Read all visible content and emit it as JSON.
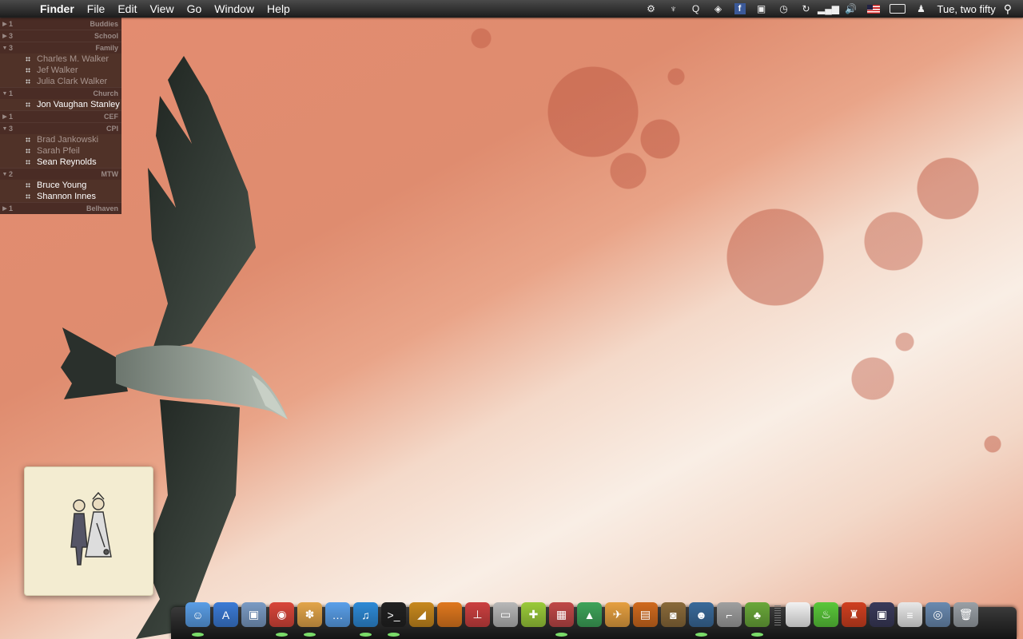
{
  "menubar": {
    "app_name": "Finder",
    "menus": [
      "File",
      "Edit",
      "View",
      "Go",
      "Window",
      "Help"
    ],
    "status_icons": [
      "gear-icon",
      "wine-glass-icon",
      "q-icon",
      "dropbox-icon",
      "facebook-icon",
      "display-icon",
      "time-machine-icon",
      "sync-icon",
      "signal-icon",
      "volume-icon",
      "us-flag-icon",
      "battery-icon",
      "user-icon"
    ],
    "facebook_glyph": "f",
    "clock": "Tue, two fifty"
  },
  "buddy_list": {
    "groups": [
      {
        "name": "Buddies",
        "count": "1",
        "expanded": false,
        "buddies": []
      },
      {
        "name": "School",
        "count": "3",
        "expanded": false,
        "buddies": []
      },
      {
        "name": "Family",
        "count": "3",
        "expanded": true,
        "buddies": [
          {
            "name": "Charles M. Walker",
            "status": "away"
          },
          {
            "name": "Jef Walker",
            "status": "away"
          },
          {
            "name": "Julia Clark Walker",
            "status": "away"
          }
        ]
      },
      {
        "name": "Church",
        "count": "1",
        "expanded": true,
        "buddies": [
          {
            "name": "Jon Vaughan Stanley",
            "status": "online"
          }
        ]
      },
      {
        "name": "CEF",
        "count": "1",
        "expanded": false,
        "buddies": []
      },
      {
        "name": "CPI",
        "count": "3",
        "expanded": true,
        "buddies": [
          {
            "name": "Brad Jankowski",
            "status": "away"
          },
          {
            "name": "Sarah Pfeil",
            "status": "away"
          },
          {
            "name": "Sean Reynolds",
            "status": "online"
          }
        ]
      },
      {
        "name": "MTW",
        "count": "2",
        "expanded": true,
        "buddies": [
          {
            "name": "Bruce Young",
            "status": "online"
          },
          {
            "name": "Shannon Innes",
            "status": "online"
          }
        ]
      },
      {
        "name": "Belhaven",
        "count": "1",
        "expanded": false,
        "buddies": []
      }
    ]
  },
  "dock": {
    "apps": [
      {
        "name": "finder-icon",
        "color": "#5a9ee6",
        "running": true,
        "glyph": "☺"
      },
      {
        "name": "app-store-icon",
        "color": "#3b7bd6",
        "running": false,
        "glyph": "A"
      },
      {
        "name": "preview-icon",
        "color": "#7b9bc4",
        "running": false,
        "glyph": "▣"
      },
      {
        "name": "chrome-icon",
        "color": "#d9463a",
        "running": true,
        "glyph": "◉"
      },
      {
        "name": "adium-icon",
        "color": "#e3a54a",
        "running": true,
        "glyph": "✽"
      },
      {
        "name": "ichat-icon",
        "color": "#5aa0ea",
        "running": false,
        "glyph": "…"
      },
      {
        "name": "itunes-icon",
        "color": "#2e8ad6",
        "running": true,
        "glyph": "♫"
      },
      {
        "name": "terminal-icon",
        "color": "#222222",
        "running": true,
        "glyph": ">_"
      },
      {
        "name": "coda-icon",
        "color": "#c8891e",
        "running": false,
        "glyph": "◢"
      },
      {
        "name": "presentation-icon",
        "color": "#e0781e",
        "running": false,
        "glyph": ""
      },
      {
        "name": "joystick-icon",
        "color": "#cc4040",
        "running": false,
        "glyph": "⊥"
      },
      {
        "name": "printer-icon",
        "color": "#b8b8b8",
        "running": false,
        "glyph": "▭"
      },
      {
        "name": "puzzle-icon",
        "color": "#9bcb3a",
        "running": false,
        "glyph": "✚"
      },
      {
        "name": "photo-booth-icon",
        "color": "#c04848",
        "running": true,
        "glyph": "▦"
      },
      {
        "name": "delta-icon",
        "color": "#3ea45a",
        "running": false,
        "glyph": "▲"
      },
      {
        "name": "transmit-icon",
        "color": "#e6a040",
        "running": false,
        "glyph": "✈"
      },
      {
        "name": "keynote-icon",
        "color": "#d06a1e",
        "running": false,
        "glyph": "▤"
      },
      {
        "name": "image-capture-icon",
        "color": "#8a6a3a",
        "running": false,
        "glyph": "◙"
      },
      {
        "name": "ninja-icon",
        "color": "#3a6a9a",
        "running": true,
        "glyph": "☻"
      },
      {
        "name": "wrench-icon",
        "color": "#a0a0a0",
        "running": false,
        "glyph": "⌐"
      },
      {
        "name": "plant-icon",
        "color": "#6aa83a",
        "running": true,
        "glyph": "♣"
      }
    ],
    "docs": [
      {
        "name": "document-icon",
        "color": "#f2f2f2",
        "glyph": ""
      },
      {
        "name": "potion-icon",
        "color": "#5ac83a",
        "glyph": "♨"
      },
      {
        "name": "mario-icon",
        "color": "#d04020",
        "glyph": "♜"
      },
      {
        "name": "photo-stack-icon",
        "color": "#3a3a5a",
        "glyph": "▣"
      },
      {
        "name": "text-file-icon",
        "color": "#e8e8e8",
        "glyph": "≡"
      },
      {
        "name": "downloads-icon",
        "color": "#6a8ab0",
        "glyph": "◎"
      }
    ],
    "trash": {
      "name": "trash-icon",
      "color": "#9aa0a6",
      "glyph": "🗑"
    }
  }
}
